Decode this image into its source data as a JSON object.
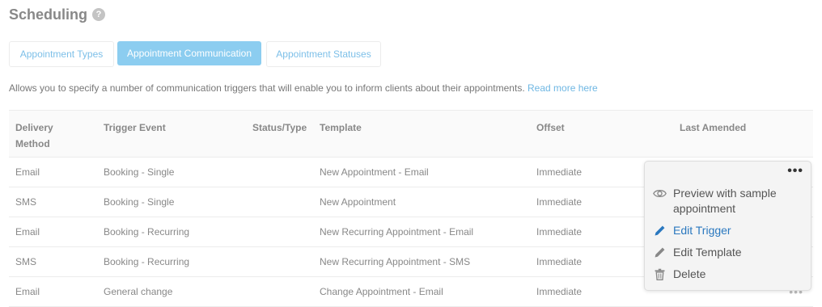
{
  "page": {
    "title": "Scheduling",
    "help": "?"
  },
  "tabs": [
    {
      "label": "Appointment Types",
      "active": false
    },
    {
      "label": "Appointment Communication",
      "active": true
    },
    {
      "label": "Appointment Statuses",
      "active": false
    }
  ],
  "description": {
    "text": "Allows you to specify a number of communication triggers that will enable you to inform clients about their appointments.",
    "link": "Read more here"
  },
  "table": {
    "columns": [
      "Delivery Method",
      "Trigger Event",
      "Status/Type",
      "Template",
      "Offset",
      "Last Amended"
    ],
    "rows": [
      {
        "method": "Email",
        "event": "Booking - Single",
        "status": "",
        "template": "New Appointment - Email",
        "offset": "Immediate",
        "amended": ""
      },
      {
        "method": "SMS",
        "event": "Booking - Single",
        "status": "",
        "template": "New Appointment",
        "offset": "Immediate",
        "amended": ""
      },
      {
        "method": "Email",
        "event": "Booking - Recurring",
        "status": "",
        "template": "New Recurring Appointment - Email",
        "offset": "Immediate",
        "amended": ""
      },
      {
        "method": "SMS",
        "event": "Booking - Recurring",
        "status": "",
        "template": "New Recurring Appointment - SMS",
        "offset": "Immediate",
        "amended": ""
      },
      {
        "method": "Email",
        "event": "General change",
        "status": "",
        "template": "Change Appointment - Email",
        "offset": "Immediate",
        "amended": ""
      }
    ]
  },
  "context_menu": {
    "items": [
      {
        "label": "Preview with sample appointment",
        "icon": "eye-icon"
      },
      {
        "label": "Edit Trigger",
        "icon": "pencil-icon",
        "highlighted": true
      },
      {
        "label": "Edit Template",
        "icon": "pencil-icon"
      },
      {
        "label": "Delete",
        "icon": "trash-icon"
      }
    ]
  },
  "colors": {
    "accent": "#8ccdf0",
    "link": "#6fb7e3",
    "highlight": "#2a78bf"
  }
}
